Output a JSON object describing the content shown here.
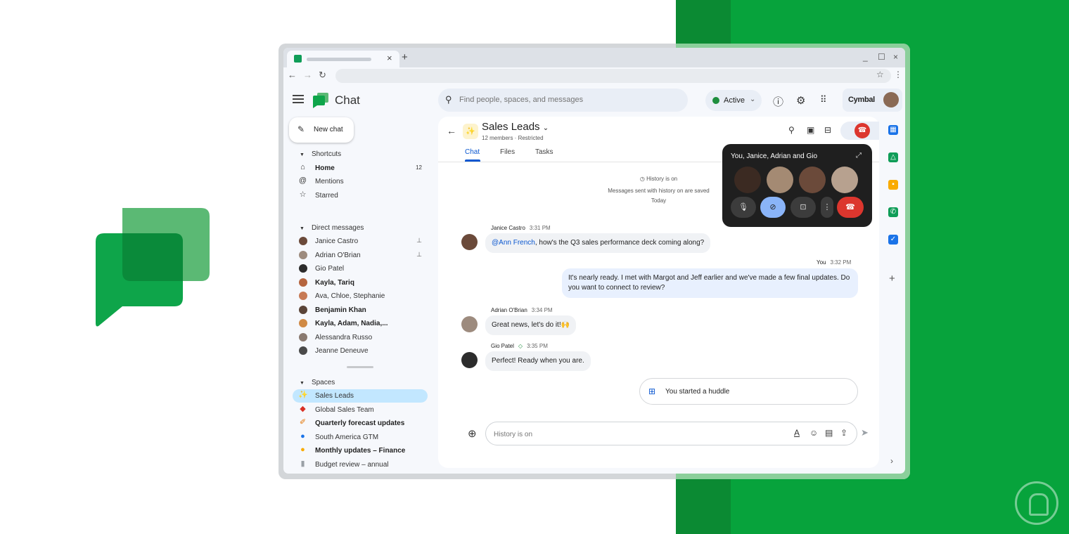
{
  "colors": {
    "brand_green": "#07a33c",
    "accent_blue": "#0b57d0",
    "end_call_red": "#dc362e",
    "active_chip": "#c2e7ff"
  },
  "browser": {
    "tab_close": "×",
    "new_tab": "+",
    "win_min": "_",
    "win_max": "☐",
    "win_close": "×"
  },
  "app": {
    "title": "Chat"
  },
  "search": {
    "placeholder": "Find people, spaces, and messages"
  },
  "status": {
    "label": "Active"
  },
  "org": {
    "name": "Cymbal"
  },
  "sidebar": {
    "new_chat": "New chat",
    "shortcuts_header": "Shortcuts",
    "shortcuts": [
      {
        "label": "Home",
        "count": "12",
        "icon": "home-icon",
        "bold": true
      },
      {
        "label": "Mentions",
        "icon": "at-icon"
      },
      {
        "label": "Starred",
        "icon": "star-icon"
      }
    ],
    "dm_header": "Direct messages",
    "direct_messages": [
      {
        "label": "Janice Castro",
        "pinned": true
      },
      {
        "label": "Adrian O'Brian",
        "pinned": true
      },
      {
        "label": "Gio Patel"
      },
      {
        "label": "Kayla, Tariq",
        "bold": true
      },
      {
        "label": "Ava, Chloe, Stephanie"
      },
      {
        "label": "Benjamin Khan",
        "bold": true
      },
      {
        "label": "Kayla, Adam, Nadia,...",
        "bold": true
      },
      {
        "label": "Alessandra Russo"
      },
      {
        "label": "Jeanne Deneuve"
      }
    ],
    "spaces_header": "Spaces",
    "spaces": [
      {
        "label": "Sales Leads",
        "active": true
      },
      {
        "label": "Global Sales Team"
      },
      {
        "label": "Quarterly forecast updates",
        "bold": true
      },
      {
        "label": "South America GTM"
      },
      {
        "label": "Monthly updates – Finance",
        "bold": true
      },
      {
        "label": "Budget review – annual"
      }
    ]
  },
  "space": {
    "title": "Sales Leads",
    "subtitle": "12 members · Restricted",
    "tabs": [
      "Chat",
      "Files",
      "Tasks"
    ],
    "history_title": "History is on",
    "history_note": "Messages sent with history on are saved",
    "day": "Today"
  },
  "messages": [
    {
      "sender": "Janice Castro",
      "time": "3:31 PM",
      "mention": "@Ann French",
      "text": ", how's the Q3 sales performance deck coming along?"
    },
    {
      "sender": "You",
      "time": "3:32 PM",
      "text": "It's nearly ready. I met with Margot and Jeff earlier and we've made a few final updates. Do you want to connect to review?"
    },
    {
      "sender": "Adrian O'Brian",
      "time": "3:34 PM",
      "text": "Great news, let's do it!🙌"
    },
    {
      "sender": "Gio Patel",
      "time": "3:35 PM",
      "text": "Perfect! Ready when you are."
    }
  ],
  "huddle_notice": "You started a huddle",
  "compose": {
    "placeholder": "History is on"
  },
  "huddle_popup": {
    "title": "You, Janice, Adrian and Gio"
  }
}
